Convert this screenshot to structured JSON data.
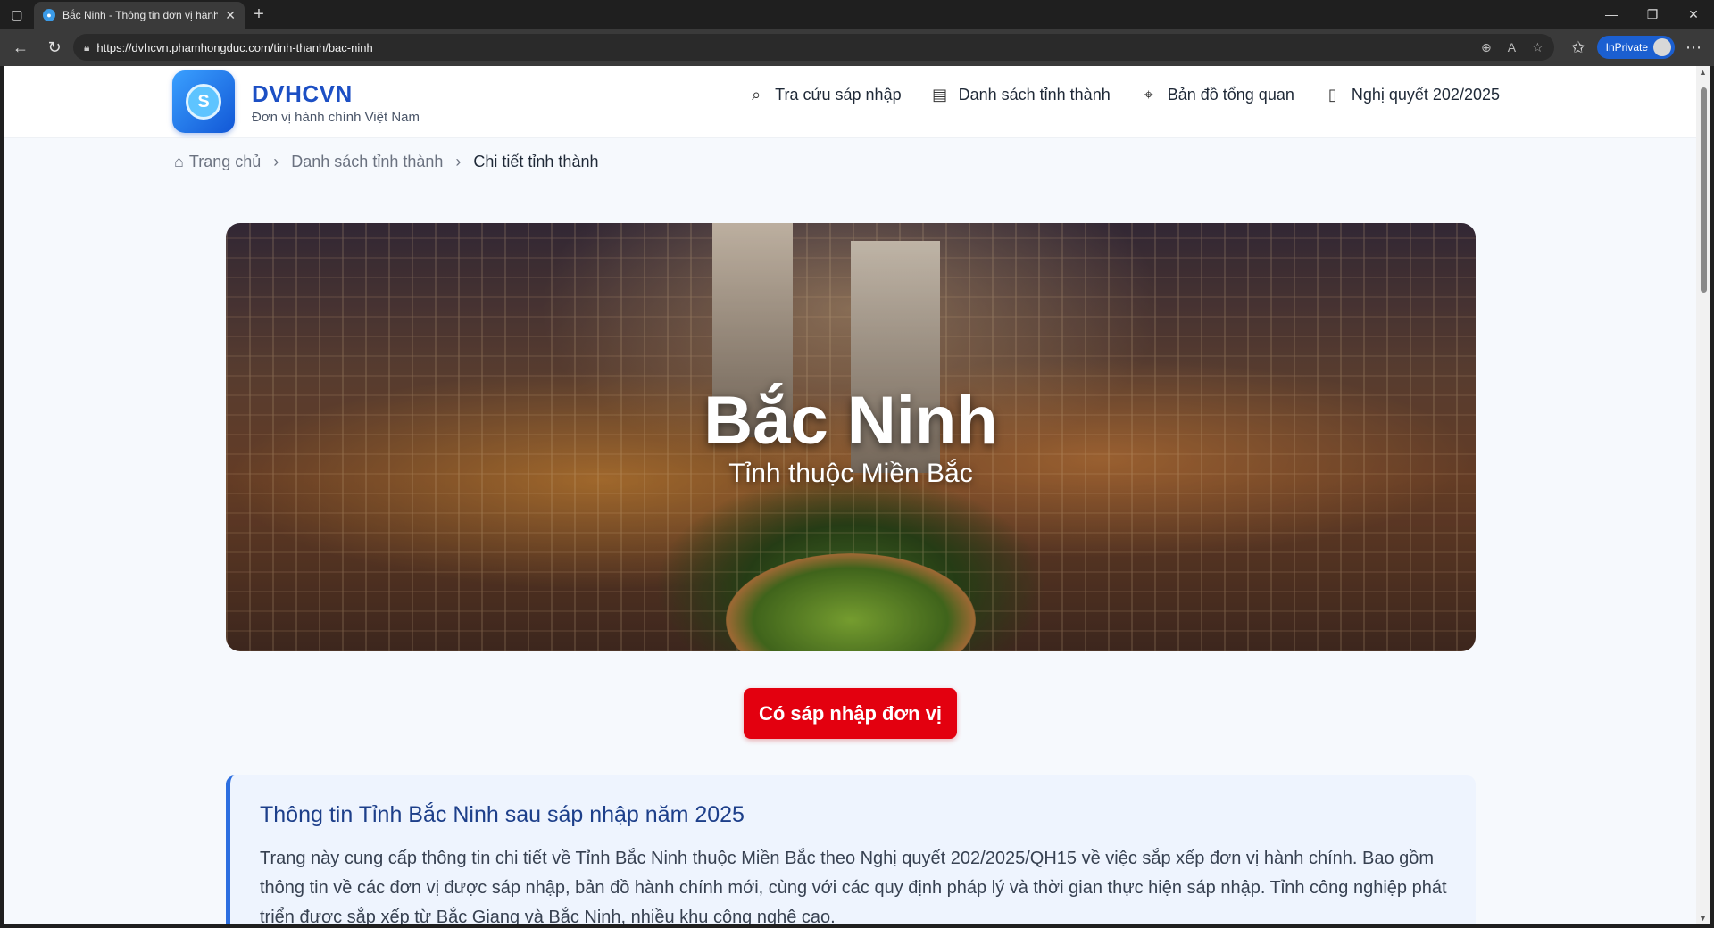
{
  "browser": {
    "tab_title": "Bắc Ninh - Thông tin đơn vị hành chính",
    "url": "https://dvhcvn.phamhongduc.com/tinh-thanh/bac-ninh",
    "inprivate_label": "InPrivate"
  },
  "header": {
    "brand_name": "DVHCVN",
    "brand_sub": "Đơn vị hành chính Việt Nam",
    "nav": [
      {
        "label": "Tra cứu sáp nhập",
        "icon": "search-icon"
      },
      {
        "label": "Danh sách tỉnh thành",
        "icon": "building-icon"
      },
      {
        "label": "Bản đồ tổng quan",
        "icon": "map-pin-icon"
      },
      {
        "label": "Nghị quyết 202/2025",
        "icon": "document-icon"
      }
    ]
  },
  "breadcrumb": {
    "home": "Trang chủ",
    "list": "Danh sách tỉnh thành",
    "current": "Chi tiết tỉnh thành"
  },
  "hero": {
    "title": "Bắc Ninh",
    "subtitle": "Tỉnh thuộc Miền Bắc"
  },
  "merge_button": "Có sáp nhập đơn vị",
  "info": {
    "heading": "Thông tin Tỉnh Bắc Ninh sau sáp nhập năm 2025",
    "body": "Trang này cung cấp thông tin chi tiết về Tỉnh Bắc Ninh thuộc Miền Bắc theo Nghị quyết 202/2025/QH15 về việc sắp xếp đơn vị hành chính. Bao gồm thông tin về các đơn vị được sáp nhập, bản đồ hành chính mới, cùng với các quy định pháp lý và thời gian thực hiện sáp nhập. Tỉnh công nghiệp phát triển được sắp xếp từ Bắc Giang và Bắc Ninh, nhiều khu công nghệ cao."
  },
  "colors": {
    "brand_blue": "#1c4fc4",
    "merge_red": "#e3000f",
    "info_bg": "#eef4fe",
    "info_accent": "#2d6fe0"
  }
}
